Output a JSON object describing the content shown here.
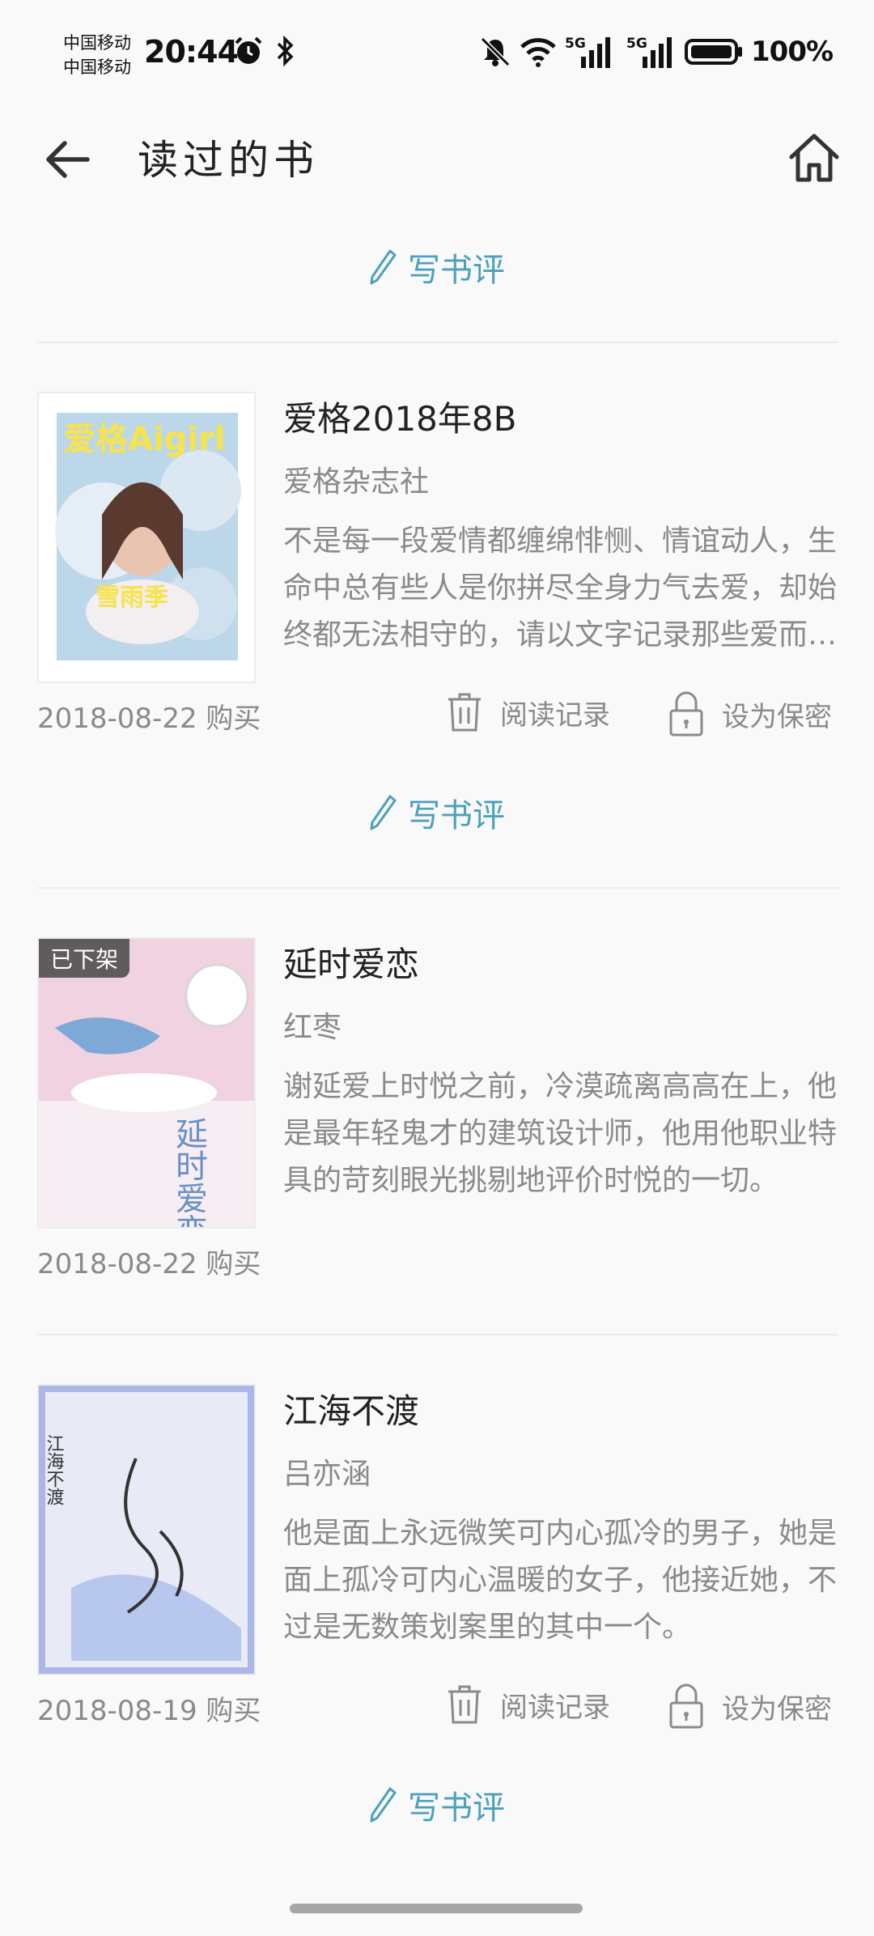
{
  "status_bar": {
    "carrier1": "中国移动",
    "carrier2": "中国移动",
    "time": "20:44",
    "net1": "5G",
    "net2": "5G",
    "battery": "100%"
  },
  "header": {
    "title": "读过的书"
  },
  "review_label": "写书评",
  "books": [
    {
      "title": "爱格2018年8B",
      "author": "爱格杂志社",
      "description": "不是每一段爱情都缠绵悱恻、情谊动人，生命中总有些人是你拼尽全身力气去爱，却始终都无法相守的，请以文字记录那些爱而不得的故事。",
      "purchase": "2018-08-22 购买",
      "read_record": "阅读记录",
      "set_private": "设为保密",
      "cover_text": "爱格Aigirl",
      "cover_sub": "雪雨季"
    },
    {
      "title": "延时爱恋",
      "author": "红枣",
      "description": "谢延爱上时悦之前，冷漠疏离高高在上，他是最年轻鬼才的建筑设计师，他用他职业特具的苛刻眼光挑剔地评价时悦的一切。",
      "purchase": "2018-08-22 购买",
      "badge": "已下架",
      "cover_text": "延时爱恋"
    },
    {
      "title": "江海不渡",
      "author": "吕亦涵",
      "description": "他是面上永远微笑可内心孤冷的男子，她是面上孤冷可内心温暖的女子，他接近她，不过是无数策划案里的其中一个。",
      "purchase": "2018-08-19 购买",
      "read_record": "阅读记录",
      "set_private": "设为保密",
      "cover_text": "江海不渡"
    }
  ]
}
